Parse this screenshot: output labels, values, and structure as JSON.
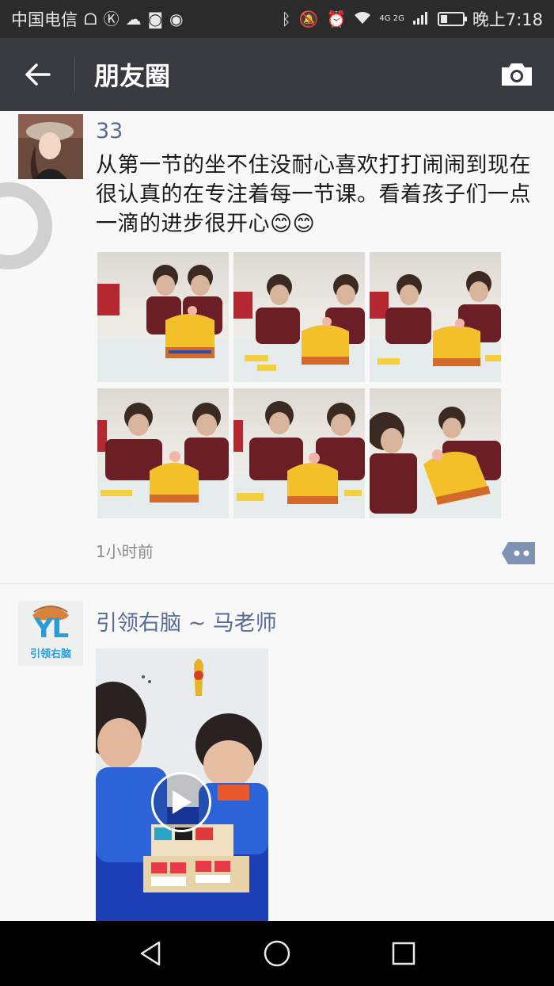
{
  "status_bar": {
    "carrier": "中国电信",
    "network": "4G 2G",
    "time": "晚上7:18",
    "icons": [
      "notification-app-icon",
      "k-app-icon",
      "cloud-icon",
      "q-app-icon",
      "weibo-icon",
      "bluetooth-icon",
      "mute-icon",
      "alarm-icon",
      "wifi-icon",
      "signal-icon",
      "battery-icon"
    ]
  },
  "nav": {
    "title": "朋友圈",
    "back_icon": "arrow-left-icon",
    "camera_icon": "camera-icon"
  },
  "posts": [
    {
      "author": "33",
      "text": "从第一节的坐不住没耐心喜欢打打闹闹到现在很认真的在专注着每一节课。看着孩子们一点一滴的进步很开心😊😊",
      "photo_count": 6,
      "timestamp": "1小时前",
      "comment_icon": "comment-more-icon"
    },
    {
      "author": "引领右脑 ~ 马老师",
      "avatar_logo_text": "YL",
      "avatar_caption": "引领右脑",
      "media": "video",
      "play_icon": "play-icon"
    }
  ],
  "system_nav": {
    "icons": [
      "back-triangle-icon",
      "home-circle-icon",
      "recents-square-icon"
    ]
  },
  "colors": {
    "status_bar_bg": "#2b2b2b",
    "nav_bar_bg": "#393a3f",
    "author_name": "#576b95",
    "feed_bg": "#f8f8f8"
  }
}
